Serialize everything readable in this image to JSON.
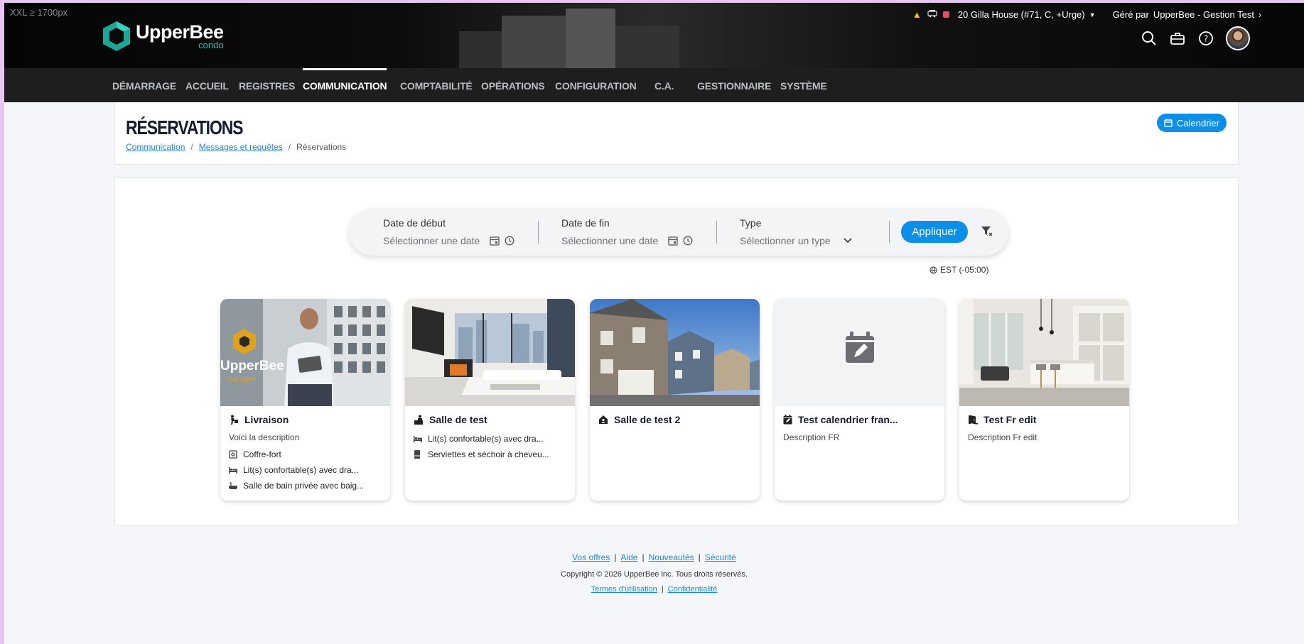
{
  "viewport_label": "XXL ≥ 1700px",
  "brand": {
    "name": "UpperBee",
    "sub": "condo"
  },
  "top_info": {
    "building": "20 Gilla House (#71, C, +Urge)",
    "managed_by_prefix": "Géré par",
    "managed_by": "UpperBee - Gestion Test"
  },
  "nav": [
    {
      "label": "DÉMARRAGE",
      "active": false
    },
    {
      "label": "ACCUEIL",
      "active": false
    },
    {
      "label": "REGISTRES",
      "active": false
    },
    {
      "label": "COMMUNICATION",
      "active": true
    },
    {
      "label": "COMPTABILITÉ",
      "active": false
    },
    {
      "label": "OPÉRATIONS",
      "active": false
    },
    {
      "label": "CONFIGURATION",
      "active": false
    },
    {
      "label": "C.A.",
      "active": false
    },
    {
      "label": "GESTIONNAIRE",
      "active": false
    },
    {
      "label": "SYSTÈME",
      "active": false
    }
  ],
  "page": {
    "title": "RÉSERVATIONS",
    "calendar_button": "Calendrier",
    "breadcrumb": [
      "Communication",
      "Messages et requêtes",
      "Réservations"
    ]
  },
  "filter": {
    "start_label": "Date de début",
    "start_placeholder": "Sélectionner une date",
    "end_label": "Date de fin",
    "end_placeholder": "Sélectionner une date",
    "type_label": "Type",
    "type_placeholder": "Sélectionner un type",
    "apply": "Appliquer",
    "timezone": "EST (-05:00)"
  },
  "cards": [
    {
      "title": "Livraison",
      "title_icon": "delivery-person-icon",
      "image": "upperbee-manager-photo",
      "description": "Voici la description",
      "features": [
        {
          "icon": "safe-icon",
          "text": "Coffre-fort"
        },
        {
          "icon": "bed-icon",
          "text": "Lit(s) confortable(s) avec dra..."
        },
        {
          "icon": "bathtub-icon",
          "text": "Salle de bain privée avec baig..."
        }
      ]
    },
    {
      "title": "Salle de test",
      "title_icon": "person-desk-icon",
      "image": "living-room-photo",
      "description": "",
      "features": [
        {
          "icon": "bed-icon",
          "text": "Lit(s) confortable(s) avec dra..."
        },
        {
          "icon": "towel-icon",
          "text": "Serviettes et séchoir à cheveu..."
        }
      ]
    },
    {
      "title": "Salle de test 2",
      "title_icon": "house-user-icon",
      "image": "townhouses-photo",
      "description": "",
      "features": []
    },
    {
      "title": "Test calendrier fran...",
      "title_icon": "calendar-edit-icon",
      "image": "calendar-placeholder",
      "description": "Description FR",
      "features": []
    },
    {
      "title": "Test Fr edit",
      "title_icon": "door-open-icon",
      "image": "kitchen-photo",
      "description": "Description Fr edit",
      "features": []
    }
  ],
  "footer": {
    "links": [
      "Vos offres",
      "Aide",
      "Nouveautés",
      "Sécurité"
    ],
    "copyright": "Copyright © 2026 UpperBee inc. Tous droits réservés.",
    "legal": [
      "Termes d'utilisation",
      "Confidentialité"
    ]
  },
  "colors": {
    "accent": "#0b8fe8",
    "nav_bg": "#1e1e1e",
    "brand_teal": "#2bc1b0"
  }
}
